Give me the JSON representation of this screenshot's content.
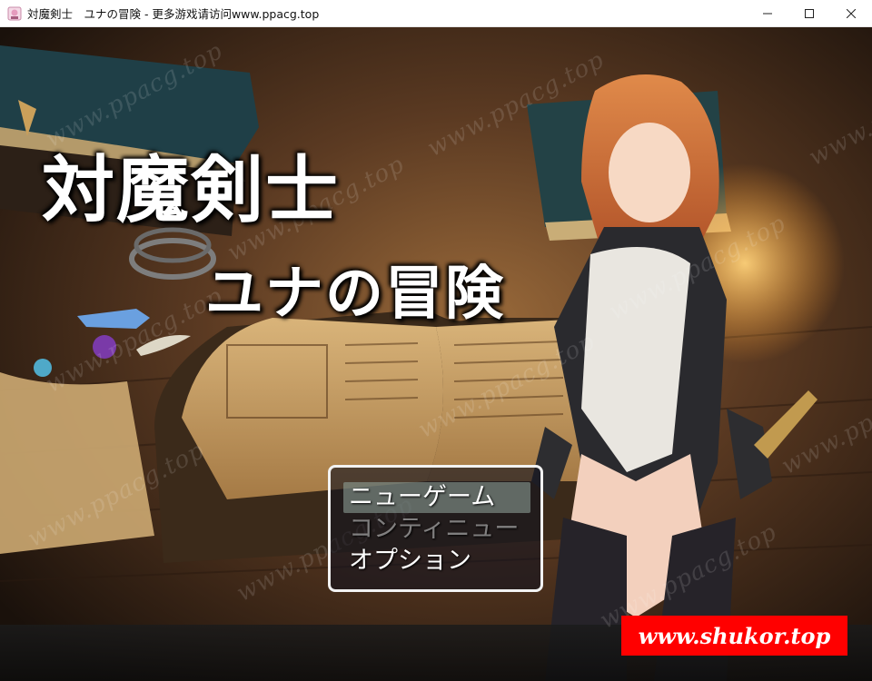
{
  "window": {
    "title": "対魔剣士　ユナの冒険 - 更多游戏请访问www.ppacg.top",
    "controls": [
      "minimize-icon",
      "maximize-icon",
      "close-icon"
    ]
  },
  "game": {
    "title_line1": "対魔剣士",
    "title_line2": "ユナの冒険",
    "menu": {
      "items": [
        {
          "label": "ニューゲーム",
          "state": "selected"
        },
        {
          "label": "コンティニュー",
          "state": "disabled"
        },
        {
          "label": "オプション",
          "state": "normal"
        }
      ]
    },
    "watermark_text": "www.ppacg.top",
    "banner_text": "www.shukor.top",
    "colors": {
      "banner": "#ff0000",
      "menu_border": "#f2f2f2",
      "selection": "#96aaa0"
    }
  }
}
